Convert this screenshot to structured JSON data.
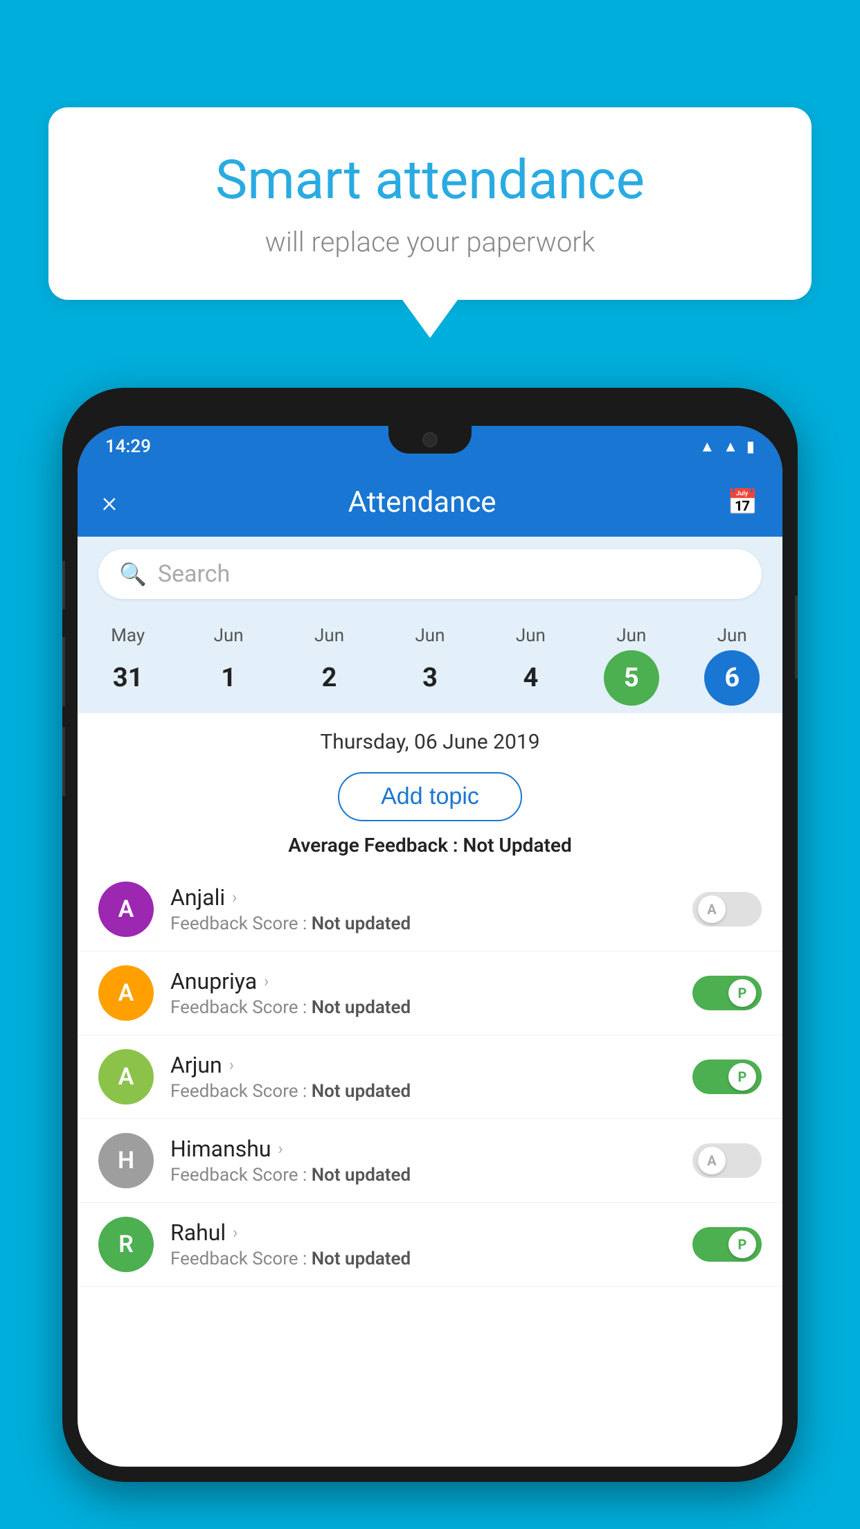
{
  "background_color": "#00AEDB",
  "speech_bubble": {
    "title": "Smart attendance",
    "subtitle": "will replace your paperwork"
  },
  "status_bar": {
    "time": "14:29",
    "icons": [
      "wifi",
      "signal",
      "battery"
    ]
  },
  "app_bar": {
    "title": "Attendance",
    "close_label": "×",
    "calendar_icon": "📅"
  },
  "search": {
    "placeholder": "Search"
  },
  "calendar": {
    "days": [
      {
        "month": "May",
        "num": "31",
        "state": "normal"
      },
      {
        "month": "Jun",
        "num": "1",
        "state": "normal"
      },
      {
        "month": "Jun",
        "num": "2",
        "state": "normal"
      },
      {
        "month": "Jun",
        "num": "3",
        "state": "normal"
      },
      {
        "month": "Jun",
        "num": "4",
        "state": "normal"
      },
      {
        "month": "Jun",
        "num": "5",
        "state": "today"
      },
      {
        "month": "Jun",
        "num": "6",
        "state": "selected"
      }
    ]
  },
  "selected_date": "Thursday, 06 June 2019",
  "add_topic_label": "Add topic",
  "avg_feedback_label": "Average Feedback :",
  "avg_feedback_value": "Not Updated",
  "students": [
    {
      "name": "Anjali",
      "avatar_letter": "A",
      "avatar_color": "#9C27B0",
      "feedback": "Not updated",
      "toggle_state": "absent",
      "toggle_letter": "A"
    },
    {
      "name": "Anupriya",
      "avatar_letter": "A",
      "avatar_color": "#FFA000",
      "feedback": "Not updated",
      "toggle_state": "present",
      "toggle_letter": "P"
    },
    {
      "name": "Arjun",
      "avatar_letter": "A",
      "avatar_color": "#8BC34A",
      "feedback": "Not updated",
      "toggle_state": "present",
      "toggle_letter": "P"
    },
    {
      "name": "Himanshu",
      "avatar_letter": "H",
      "avatar_color": "#9E9E9E",
      "feedback": "Not updated",
      "toggle_state": "absent",
      "toggle_letter": "A"
    },
    {
      "name": "Rahul",
      "avatar_letter": "R",
      "avatar_color": "#4CAF50",
      "feedback": "Not updated",
      "toggle_state": "present",
      "toggle_letter": "P"
    }
  ],
  "feedback_score_label": "Feedback Score :"
}
